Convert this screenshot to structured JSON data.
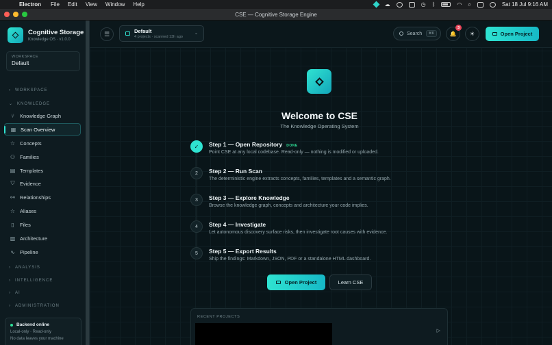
{
  "menubar": {
    "app": "Electron",
    "items": [
      "File",
      "Edit",
      "View",
      "Window",
      "Help"
    ],
    "clock": "Sat 18 Jul  9:16 AM"
  },
  "window": {
    "title": "CSE — Cognitive Storage Engine"
  },
  "sidebar": {
    "brand_title": "Cognitive Storage",
    "brand_sub": "Knowledge OS · v1.0.0",
    "workspace_label": "WORKSPACE",
    "workspace_value": "Default",
    "sections": {
      "workspace": "WORKSPACE",
      "knowledge": "KNOWLEDGE",
      "analysis": "ANALYSIS",
      "intelligence": "INTELLIGENCE",
      "ai": "AI",
      "administration": "ADMINISTRATION"
    },
    "items": [
      {
        "label": "Knowledge Graph",
        "icon": "graph-icon"
      },
      {
        "label": "Scan Overview",
        "icon": "scan-icon"
      },
      {
        "label": "Concepts",
        "icon": "concepts-icon"
      },
      {
        "label": "Families",
        "icon": "families-icon"
      },
      {
        "label": "Templates",
        "icon": "templates-icon"
      },
      {
        "label": "Evidence",
        "icon": "shield-icon"
      },
      {
        "label": "Relationships",
        "icon": "relationships-icon"
      },
      {
        "label": "Aliases",
        "icon": "star-icon"
      },
      {
        "label": "Files",
        "icon": "file-icon"
      },
      {
        "label": "Architecture",
        "icon": "architecture-icon"
      },
      {
        "label": "Pipeline",
        "icon": "pipeline-icon"
      }
    ],
    "status": {
      "title": "Backend online",
      "line1": "Local-only · Read-only",
      "line2": "No data leaves your machine"
    }
  },
  "topbar": {
    "workspace_title": "Default",
    "workspace_meta": "4 projects · scanned 13h ago",
    "search_label": "Search",
    "search_kbd": "⌘K",
    "notif_count": "3",
    "open_project": "Open Project"
  },
  "hero": {
    "title": "Welcome to CSE",
    "subtitle": "The Knowledge Operating System"
  },
  "steps": [
    {
      "num": "✓",
      "title": "Step 1 — Open Repository",
      "badge": "DONE",
      "desc": "Point CSE at any local codebase. Read-only — nothing is modified or uploaded."
    },
    {
      "num": "2",
      "title": "Step 2 — Run Scan",
      "desc": "The deterministic engine extracts concepts, families, templates and a semantic graph."
    },
    {
      "num": "3",
      "title": "Step 3 — Explore Knowledge",
      "desc": "Browse the knowledge graph, concepts and architecture your code implies."
    },
    {
      "num": "4",
      "title": "Step 4 — Investigate",
      "desc": "Let autonomous discovery surface risks, then investigate root causes with evidence."
    },
    {
      "num": "5",
      "title": "Step 5 — Export Results",
      "desc": "Ship the findings: Markdown, JSON, PDF or a standalone HTML dashboard."
    }
  ],
  "actions": {
    "open_project": "Open Project",
    "learn": "Learn CSE"
  },
  "recent": {
    "header": "RECENT PROJECTS"
  },
  "colors": {
    "accent": "#2fe3d1",
    "background": "#0a1418",
    "notification": "#e8465a",
    "online": "#2fe39a"
  }
}
